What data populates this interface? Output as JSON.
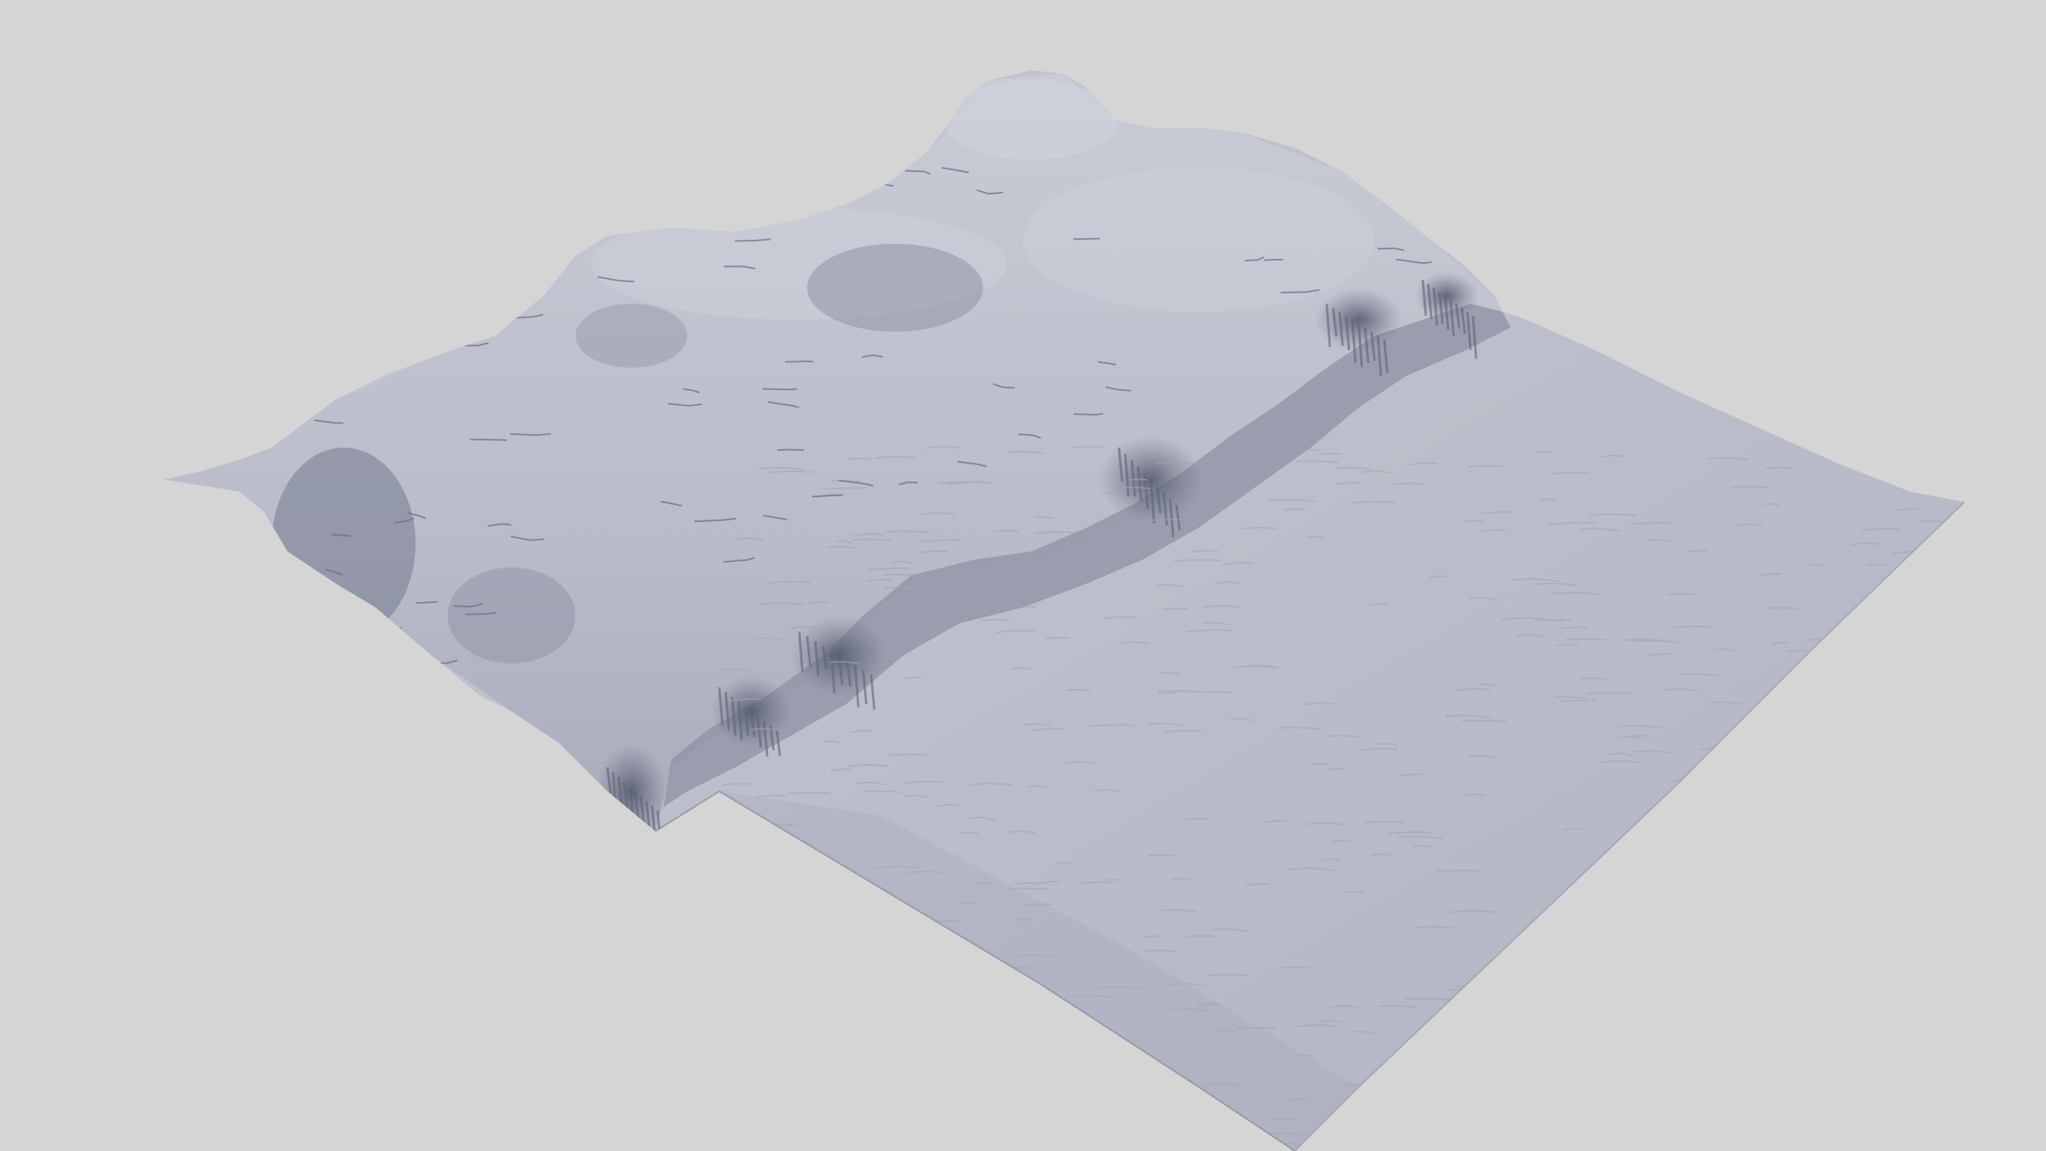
{
  "scene": {
    "subject": "terrain-mesh",
    "colors": {
      "background": "#d5d5d5",
      "surface_light": "#c2c5d0",
      "surface_mid": "#aeb1bf",
      "surface_shadow": "#5d6276",
      "cliff_dark": "#464b5e",
      "ripple": "#9da1b1"
    }
  }
}
